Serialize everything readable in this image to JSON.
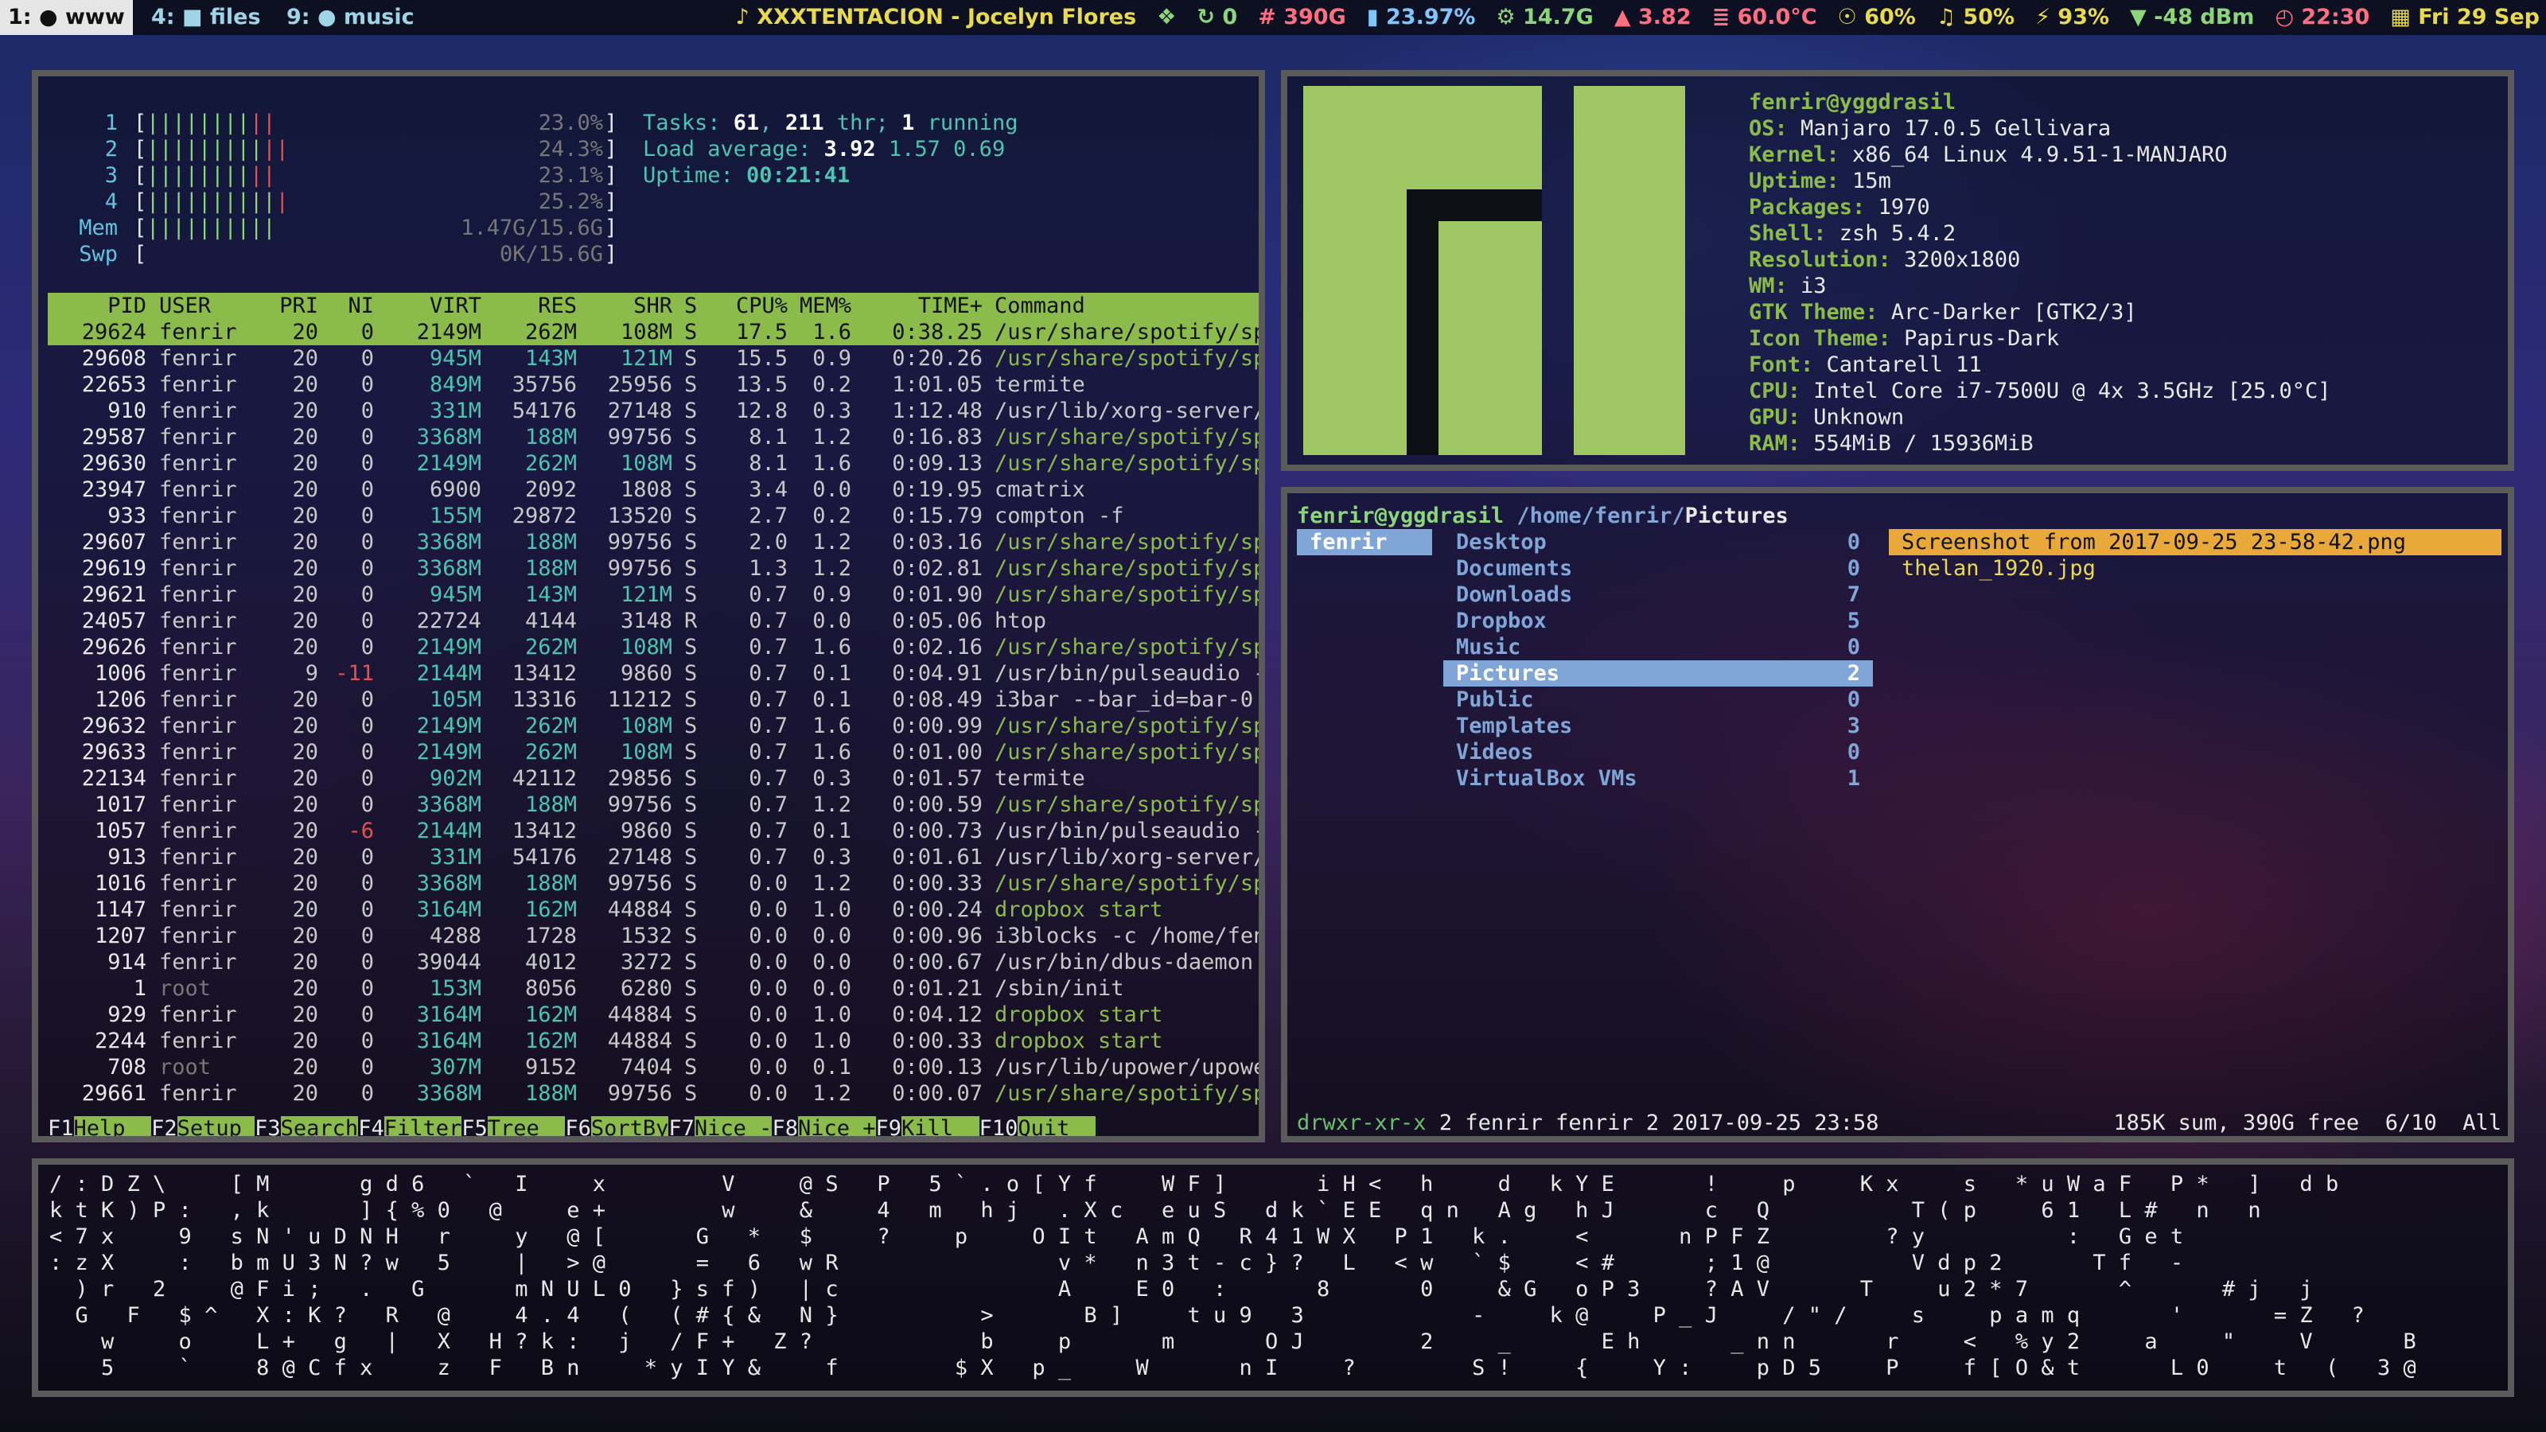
{
  "bar": {
    "workspaces": [
      {
        "label": "1: ● www",
        "active": true
      },
      {
        "label": "4: ■ files",
        "active": false
      },
      {
        "label": "9: ● music",
        "active": false
      }
    ],
    "blocks": {
      "music": "♪ XXXTENTACION - Jocelyn Flores",
      "dropbox": "❖",
      "updates": "↻ 0",
      "disk": "# 390G",
      "memory": "▮ 23.97%",
      "cpu_freq": "⚙ 14.7G",
      "load": "▲ 3.82",
      "temp": "≣ 60.0°C",
      "brightness": "☉ 60%",
      "volume": "♫ 50%",
      "battery": "⚡ 93%",
      "wifi": "▼ -48 dBm",
      "time": "◴ 22:30",
      "date": "▦ Fri 29 Sep"
    },
    "colors": {
      "accent": "#9fd3e6",
      "yellow": "#e8d94f",
      "green": "#8bd67a"
    }
  },
  "htop": {
    "meters": [
      {
        "label": "1",
        "bar": "||||||||",
        "bar_red": "||",
        "value": "23.0%"
      },
      {
        "label": "2",
        "bar": "|||||||||",
        "bar_red": "||",
        "value": "24.3%"
      },
      {
        "label": "3",
        "bar": "||||||||",
        "bar_red": "||",
        "value": "23.1%"
      },
      {
        "label": "4",
        "bar": "||||||||||",
        "bar_red": "|",
        "value": "25.2%"
      },
      {
        "label": "Mem",
        "bar": "||||||||||",
        "bar_red": "",
        "value": "1.47G/15.6G"
      },
      {
        "label": "Swp",
        "bar": "",
        "bar_red": "",
        "value": "0K/15.6G"
      }
    ],
    "tasks_label": "Tasks: ",
    "tasks": "61",
    "thr": "211",
    "running": "1",
    "load_label": "Load average: ",
    "load1": "3.92",
    "load5": "1.57",
    "load15": "0.69",
    "uptime_label": "Uptime: ",
    "uptime": "00:21:41",
    "headers": {
      "pid": "PID",
      "user": "USER",
      "pri": "PRI",
      "ni": "NI",
      "virt": "VIRT",
      "res": "RES",
      "shr": "SHR",
      "s": "S",
      "cpu": "CPU%",
      "mem": "MEM%",
      "time": "TIME+",
      "cmd": "Command"
    },
    "rows": [
      {
        "pid": "29624",
        "user": "fenrir",
        "pri": "20",
        "ni": "0",
        "virt": "2149M",
        "res": "262M",
        "shr": "108M",
        "s": "S",
        "cpu": "17.5",
        "mem": "1.6",
        "time": "0:38.25",
        "cmd": "/usr/share/spotify/spotify"
      },
      {
        "pid": "29608",
        "user": "fenrir",
        "pri": "20",
        "ni": "0",
        "virt": "945M",
        "res": "143M",
        "shr": "121M",
        "s": "S",
        "cpu": "15.5",
        "mem": "0.9",
        "time": "0:20.26",
        "cmd": "/usr/share/spotify/spotify"
      },
      {
        "pid": "22653",
        "user": "fenrir",
        "pri": "20",
        "ni": "0",
        "virt": "849M",
        "res": "35756",
        "shr": "25956",
        "s": "S",
        "cpu": "13.5",
        "mem": "0.2",
        "time": "1:01.05",
        "cmd": "termite"
      },
      {
        "pid": "910",
        "user": "fenrir",
        "pri": "20",
        "ni": "0",
        "virt": "331M",
        "res": "54176",
        "shr": "27148",
        "s": "S",
        "cpu": "12.8",
        "mem": "0.3",
        "time": "1:12.48",
        "cmd": "/usr/lib/xorg-server/Xorg"
      },
      {
        "pid": "29587",
        "user": "fenrir",
        "pri": "20",
        "ni": "0",
        "virt": "3368M",
        "res": "188M",
        "shr": "99756",
        "s": "S",
        "cpu": "8.1",
        "mem": "1.2",
        "time": "0:16.83",
        "cmd": "/usr/share/spotify/spotify"
      },
      {
        "pid": "29630",
        "user": "fenrir",
        "pri": "20",
        "ni": "0",
        "virt": "2149M",
        "res": "262M",
        "shr": "108M",
        "s": "S",
        "cpu": "8.1",
        "mem": "1.6",
        "time": "0:09.13",
        "cmd": "/usr/share/spotify/spotify"
      },
      {
        "pid": "23947",
        "user": "fenrir",
        "pri": "20",
        "ni": "0",
        "virt": "6900",
        "res": "2092",
        "shr": "1808",
        "s": "S",
        "cpu": "3.4",
        "mem": "0.0",
        "time": "0:19.95",
        "cmd": "cmatrix"
      },
      {
        "pid": "933",
        "user": "fenrir",
        "pri": "20",
        "ni": "0",
        "virt": "155M",
        "res": "29872",
        "shr": "13520",
        "s": "S",
        "cpu": "2.7",
        "mem": "0.2",
        "time": "0:15.79",
        "cmd": "compton -f"
      },
      {
        "pid": "29607",
        "user": "fenrir",
        "pri": "20",
        "ni": "0",
        "virt": "3368M",
        "res": "188M",
        "shr": "99756",
        "s": "S",
        "cpu": "2.0",
        "mem": "1.2",
        "time": "0:03.16",
        "cmd": "/usr/share/spotify/spotify"
      },
      {
        "pid": "29619",
        "user": "fenrir",
        "pri": "20",
        "ni": "0",
        "virt": "3368M",
        "res": "188M",
        "shr": "99756",
        "s": "S",
        "cpu": "1.3",
        "mem": "1.2",
        "time": "0:02.81",
        "cmd": "/usr/share/spotify/spotify"
      },
      {
        "pid": "29621",
        "user": "fenrir",
        "pri": "20",
        "ni": "0",
        "virt": "945M",
        "res": "143M",
        "shr": "121M",
        "s": "S",
        "cpu": "0.7",
        "mem": "0.9",
        "time": "0:01.90",
        "cmd": "/usr/share/spotify/spotify"
      },
      {
        "pid": "24057",
        "user": "fenrir",
        "pri": "20",
        "ni": "0",
        "virt": "22724",
        "res": "4144",
        "shr": "3148",
        "s": "R",
        "cpu": "0.7",
        "mem": "0.0",
        "time": "0:05.06",
        "cmd": "htop"
      },
      {
        "pid": "29626",
        "user": "fenrir",
        "pri": "20",
        "ni": "0",
        "virt": "2149M",
        "res": "262M",
        "shr": "108M",
        "s": "S",
        "cpu": "0.7",
        "mem": "1.6",
        "time": "0:02.16",
        "cmd": "/usr/share/spotify/spotify"
      },
      {
        "pid": "1006",
        "user": "fenrir",
        "pri": "9",
        "ni": "-11",
        "virt": "2144M",
        "res": "13412",
        "shr": "9860",
        "s": "S",
        "cpu": "0.7",
        "mem": "0.1",
        "time": "0:04.91",
        "cmd": "/usr/bin/pulseaudio --daem"
      },
      {
        "pid": "1206",
        "user": "fenrir",
        "pri": "20",
        "ni": "0",
        "virt": "105M",
        "res": "13316",
        "shr": "11212",
        "s": "S",
        "cpu": "0.7",
        "mem": "0.1",
        "time": "0:08.49",
        "cmd": "i3bar --bar_id=bar-0 --soc"
      },
      {
        "pid": "29632",
        "user": "fenrir",
        "pri": "20",
        "ni": "0",
        "virt": "2149M",
        "res": "262M",
        "shr": "108M",
        "s": "S",
        "cpu": "0.7",
        "mem": "1.6",
        "time": "0:00.99",
        "cmd": "/usr/share/spotify/spotify"
      },
      {
        "pid": "29633",
        "user": "fenrir",
        "pri": "20",
        "ni": "0",
        "virt": "2149M",
        "res": "262M",
        "shr": "108M",
        "s": "S",
        "cpu": "0.7",
        "mem": "1.6",
        "time": "0:01.00",
        "cmd": "/usr/share/spotify/spotify"
      },
      {
        "pid": "22134",
        "user": "fenrir",
        "pri": "20",
        "ni": "0",
        "virt": "902M",
        "res": "42112",
        "shr": "29856",
        "s": "S",
        "cpu": "0.7",
        "mem": "0.3",
        "time": "0:01.57",
        "cmd": "termite"
      },
      {
        "pid": "1017",
        "user": "fenrir",
        "pri": "20",
        "ni": "0",
        "virt": "3368M",
        "res": "188M",
        "shr": "99756",
        "s": "S",
        "cpu": "0.7",
        "mem": "1.2",
        "time": "0:00.59",
        "cmd": "/usr/share/spotify/spotify"
      },
      {
        "pid": "1057",
        "user": "fenrir",
        "pri": "20",
        "ni": "-6",
        "virt": "2144M",
        "res": "13412",
        "shr": "9860",
        "s": "S",
        "cpu": "0.7",
        "mem": "0.1",
        "time": "0:00.73",
        "cmd": "/usr/bin/pulseaudio --daem"
      },
      {
        "pid": "913",
        "user": "fenrir",
        "pri": "20",
        "ni": "0",
        "virt": "331M",
        "res": "54176",
        "shr": "27148",
        "s": "S",
        "cpu": "0.7",
        "mem": "0.3",
        "time": "0:01.61",
        "cmd": "/usr/lib/xorg-server/Xorg"
      },
      {
        "pid": "1016",
        "user": "fenrir",
        "pri": "20",
        "ni": "0",
        "virt": "3368M",
        "res": "188M",
        "shr": "99756",
        "s": "S",
        "cpu": "0.0",
        "mem": "1.2",
        "time": "0:00.33",
        "cmd": "/usr/share/spotify/spotify"
      },
      {
        "pid": "1147",
        "user": "fenrir",
        "pri": "20",
        "ni": "0",
        "virt": "3164M",
        "res": "162M",
        "shr": "44884",
        "s": "S",
        "cpu": "0.0",
        "mem": "1.0",
        "time": "0:00.24",
        "cmd": "dropbox start"
      },
      {
        "pid": "1207",
        "user": "fenrir",
        "pri": "20",
        "ni": "0",
        "virt": "4288",
        "res": "1728",
        "shr": "1532",
        "s": "S",
        "cpu": "0.0",
        "mem": "0.0",
        "time": "0:00.96",
        "cmd": "i3blocks -c /home/fenrir/."
      },
      {
        "pid": "914",
        "user": "fenrir",
        "pri": "20",
        "ni": "0",
        "virt": "39044",
        "res": "4012",
        "shr": "3272",
        "s": "S",
        "cpu": "0.0",
        "mem": "0.0",
        "time": "0:00.67",
        "cmd": "/usr/bin/dbus-daemon --ses"
      },
      {
        "pid": "1",
        "user": "root",
        "pri": "20",
        "ni": "0",
        "virt": "153M",
        "res": "8056",
        "shr": "6280",
        "s": "S",
        "cpu": "0.0",
        "mem": "0.0",
        "time": "0:01.21",
        "cmd": "/sbin/init"
      },
      {
        "pid": "929",
        "user": "fenrir",
        "pri": "20",
        "ni": "0",
        "virt": "3164M",
        "res": "162M",
        "shr": "44884",
        "s": "S",
        "cpu": "0.0",
        "mem": "1.0",
        "time": "0:04.12",
        "cmd": "dropbox start"
      },
      {
        "pid": "2244",
        "user": "fenrir",
        "pri": "20",
        "ni": "0",
        "virt": "3164M",
        "res": "162M",
        "shr": "44884",
        "s": "S",
        "cpu": "0.0",
        "mem": "1.0",
        "time": "0:00.33",
        "cmd": "dropbox start"
      },
      {
        "pid": "708",
        "user": "root",
        "pri": "20",
        "ni": "0",
        "virt": "307M",
        "res": "9152",
        "shr": "7404",
        "s": "S",
        "cpu": "0.0",
        "mem": "0.1",
        "time": "0:00.13",
        "cmd": "/usr/lib/upower/upowerd"
      },
      {
        "pid": "29661",
        "user": "fenrir",
        "pri": "20",
        "ni": "0",
        "virt": "3368M",
        "res": "188M",
        "shr": "99756",
        "s": "S",
        "cpu": "0.0",
        "mem": "1.2",
        "time": "0:00.07",
        "cmd": "/usr/share/spotify/spotify"
      }
    ],
    "fkeys": [
      {
        "key": "F1",
        "label": "Help  "
      },
      {
        "key": "F2",
        "label": "Setup "
      },
      {
        "key": "F3",
        "label": "Search"
      },
      {
        "key": "F4",
        "label": "Filter"
      },
      {
        "key": "F5",
        "label": "Tree  "
      },
      {
        "key": "F6",
        "label": "SortBy"
      },
      {
        "key": "F7",
        "label": "Nice -"
      },
      {
        "key": "F8",
        "label": "Nice +"
      },
      {
        "key": "F9",
        "label": "Kill  "
      },
      {
        "key": "F10",
        "label": "Quit  "
      }
    ]
  },
  "neofetch": {
    "title": "fenrir@yggdrasil",
    "lines": [
      {
        "key": "OS:",
        "value": " Manjaro 17.0.5 Gellivara"
      },
      {
        "key": "Kernel:",
        "value": " x86_64 Linux 4.9.51-1-MANJARO"
      },
      {
        "key": "Uptime:",
        "value": " 15m"
      },
      {
        "key": "Packages:",
        "value": " 1970"
      },
      {
        "key": "Shell:",
        "value": " zsh 5.4.2"
      },
      {
        "key": "Resolution:",
        "value": " 3200x1800"
      },
      {
        "key": "WM:",
        "value": " i3"
      },
      {
        "key": "GTK Theme:",
        "value": " Arc-Darker [GTK2/3]"
      },
      {
        "key": "Icon Theme:",
        "value": " Papirus-Dark"
      },
      {
        "key": "Font:",
        "value": " Cantarell 11"
      },
      {
        "key": "CPU:",
        "value": " Intel Core i7-7500U @ 4x 3.5GHz [25.0°C]"
      },
      {
        "key": "GPU:",
        "value": " Unknown"
      },
      {
        "key": "RAM:",
        "value": " 554MiB / 15936MiB"
      }
    ],
    "logo_color": "#9fc865"
  },
  "ranger": {
    "host": "fenrir@yggdrasil",
    "path": " /home/fenrir/",
    "current": "Pictures",
    "parent": "fenrir",
    "dirs": [
      {
        "name": "Desktop",
        "count": "0"
      },
      {
        "name": "Documents",
        "count": "0"
      },
      {
        "name": "Downloads",
        "count": "7"
      },
      {
        "name": "Dropbox",
        "count": "5"
      },
      {
        "name": "Music",
        "count": "0"
      },
      {
        "name": "Pictures",
        "count": "2"
      },
      {
        "name": "Public",
        "count": "0"
      },
      {
        "name": "Templates",
        "count": "3"
      },
      {
        "name": "Videos",
        "count": "0"
      },
      {
        "name": "VirtualBox VMs",
        "count": "1"
      }
    ],
    "files": [
      "Screenshot from 2017-09-25 23-58-42.png",
      "thelan_1920.jpg"
    ],
    "status_perm": "drwxr-xr-x",
    "status_info": " 2 fenrir fenrir 2 2017-09-25 23:58",
    "status_right": "185K sum, 390G free  6/10  All"
  },
  "matrix": {
    "lines": [
      "/ : D Z \\     [ M       g d 6   `   I     x         V     @ S   P   5 ` . o [ Y f     W F ]       i H <   h     d   k Y E       !     p     K x     s   * u W a F   P *   ]   d b",
      "k t K ) P :   , k       ] { % 0   @     e +         w     &     4   m   h j   . X c   e u S   d k ` E E   q n   A g   h J       c   Q           T ( p     6 1   L #   n   n",
      "< 7 x     9   s N ' u D N H   r     y   @ [       G   *   $     ?     p     O I t   A m Q   R 4 1 W X   P 1   k .     <       n P F Z         ? y           :   G e t",
      ": z X     :   b m U 3 N ? w   5     |   > @       =   6   w R                 v *   n 3 t - c } ?   L   < w   ` $     < #       ; 1 @           V d p 2       T f   -",
      "  ) r   2     @ F i ;   .   G       m N U L 0   } s f )   | c                 A     E 0   :       8       0     & G   o P 3     ? A V       T     u 2 * 7       ^       # j   j",
      "  G   F   $ ^   X : K ?   R   @     4 . 4   (   ( # { &   N }           >       B ]     t u 9   3             -     k @     P _ J     / \" /     s     p a m q       '       = Z   ?",
      "    w     o     L +   g   |   X   H ? k :   j   / F +   Z ?             b     p       m       O J         2     _       E h       _ n n       r     <   % y 2     a     \"     V       B",
      "    5     `     8 @ C f x     z   F   B n     * y I Y &     f         $ X   p _     W       n I     ?         S !     {     Y :     p D 5     P     f [ O & t       L 0     t   (   3 @       j"
    ]
  }
}
